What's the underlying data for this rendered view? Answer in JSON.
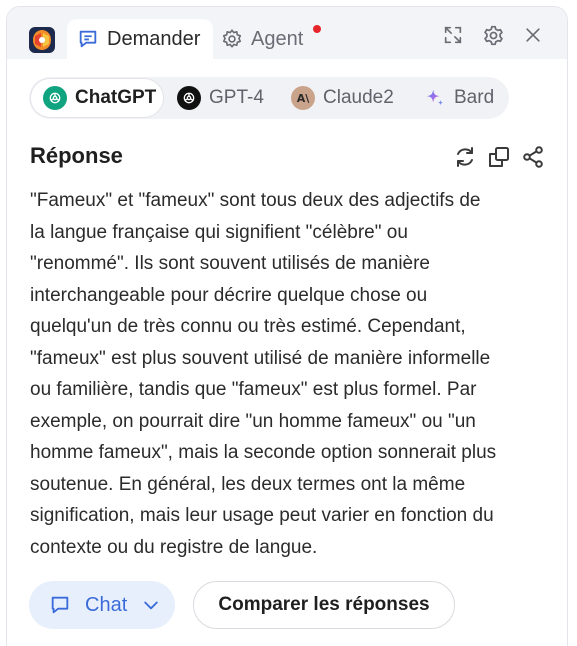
{
  "tabs": {
    "active_label": "Demander",
    "agent_label": "Agent"
  },
  "models": [
    {
      "label": "ChatGPT",
      "active": true
    },
    {
      "label": "GPT-4",
      "active": false
    },
    {
      "label": "Claude2",
      "active": false
    },
    {
      "label": "Bard",
      "active": false
    }
  ],
  "response": {
    "title": "Réponse",
    "text": "\"Fameux\" et \"fameux\" sont tous deux des adjectifs de\nla langue française qui signifient \"célèbre\" ou\n\"renommé\". Ils sont souvent utilisés de manière\ninterchangeable pour décrire quelque chose ou\nquelqu'un de très connu ou très estimé. Cependant,\n\"fameux\" est plus souvent utilisé de manière informelle\nou familière, tandis que \"fameux\" est plus formel. Par\nexemple, on pourrait dire \"un homme fameux\" ou \"un\nhomme fameux\", mais la seconde option sonnerait plus\nsoutenue. En général, les deux termes ont la même\nsignification, mais leur usage peut varier en fonction du\ncontexte ou du registre de langue."
  },
  "footer": {
    "chat_label": "Chat",
    "compare_label": "Comparer les réponses"
  },
  "icons": {
    "app_logo": "app-logo-icon",
    "chat_tab": "chat-bubble-icon",
    "agent_tab": "gear-icon",
    "expand": "expand-icon",
    "settings": "settings-icon",
    "close": "close-icon",
    "refresh": "refresh-icon",
    "copy": "copy-icon",
    "share": "share-icon"
  },
  "colors": {
    "accent": "#3a6bd9",
    "chatgpt": "#10a37f",
    "claude": "#c9a48a",
    "notification": "#e5252a"
  }
}
